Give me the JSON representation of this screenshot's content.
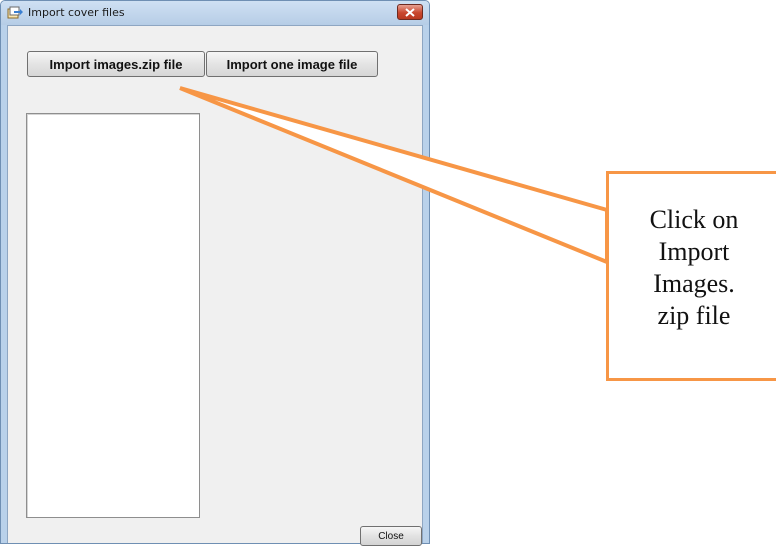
{
  "window": {
    "title": "Import cover files",
    "icon": "import-icon",
    "close_icon": "close-icon"
  },
  "buttons": {
    "import_zip_label": "Import images.zip file",
    "import_one_label": "Import one image file",
    "close_label": "Close"
  },
  "callout": {
    "lines": [
      "Click on",
      "Import",
      "Images.",
      "zip file"
    ],
    "border_color": "#f79646"
  }
}
